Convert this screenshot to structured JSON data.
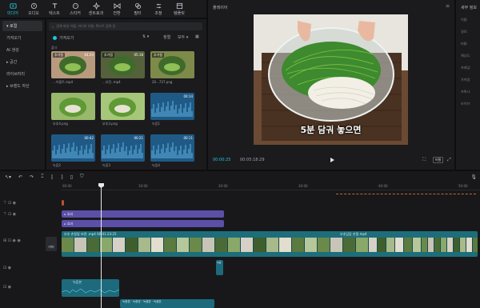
{
  "toolbar": {
    "items": [
      {
        "label": "미디어",
        "icon": "media-icon",
        "active": true
      },
      {
        "label": "오디오",
        "icon": "audio-icon"
      },
      {
        "label": "텍스트",
        "icon": "text-icon"
      },
      {
        "label": "스티커",
        "icon": "sticker-icon"
      },
      {
        "label": "센트효과",
        "icon": "effects-icon"
      },
      {
        "label": "전환",
        "icon": "transition-icon"
      },
      {
        "label": "필터",
        "icon": "filter-icon"
      },
      {
        "label": "조정",
        "icon": "adjust-icon"
      },
      {
        "label": "템플릿",
        "icon": "template-icon"
      }
    ]
  },
  "sidebar": {
    "items": [
      {
        "label": "▾ 로컬",
        "active": true
      },
      {
        "label": "가져오기"
      },
      {
        "label": "AI 생성"
      },
      {
        "label": "▸ 공간"
      },
      {
        "label": "라이브러리"
      },
      {
        "label": "▸ 브랜드 자산"
      }
    ]
  },
  "media": {
    "search_placeholder": "검색 파일 이름, 미디어 유형, 텍스트 검색 등",
    "import_label": "가져오기",
    "sort_label": "정렬",
    "filter_label": "모두",
    "section_label": "폴더",
    "items": [
      {
        "label": "...이들트.mp4",
        "duration": "04:24",
        "tag": "추가됨",
        "color": "#b89a7d"
      },
      {
        "label": "...부진..mp4",
        "duration": "05:18",
        "tag": "추가됨",
        "color": "#55613b"
      },
      {
        "label": "20...727.png",
        "duration": "",
        "tag": "추가됨",
        "color": "#7d8a4a"
      },
      {
        "label": "부추4.png",
        "duration": "",
        "tag": "",
        "color": "#98b86b"
      },
      {
        "label": "부추3.png",
        "duration": "",
        "tag": "",
        "color": "#a6c67a"
      },
      {
        "label": "녹음1",
        "duration": "00:14",
        "tag": "",
        "color": "#1f5a86"
      },
      {
        "label": "녹음2",
        "duration": "00:42",
        "tag": "",
        "color": "#1f5a86"
      },
      {
        "label": "녹음3",
        "duration": "00:21",
        "tag": "",
        "color": "#1f5a86"
      },
      {
        "label": "녹음4",
        "duration": "00:11",
        "tag": "",
        "color": "#1f5a86"
      }
    ]
  },
  "player": {
    "title": "플레이어",
    "subtitle": "5분 담궈 놓으면",
    "current_time": "00:00:25",
    "total_time": "00:05:18:29",
    "ratio_label": "비율"
  },
  "right_panel": {
    "title": "세부 정보",
    "rows": [
      "이름:",
      "경로:",
      "비율:",
      "해상도:",
      "프레임:",
      "가져옴:",
      "프록시:",
      "라이브:"
    ]
  },
  "timeline": {
    "ticks": [
      "00:00",
      "10:00",
      "20:00",
      "30:00",
      "40:00",
      "50:00"
    ],
    "tracks": [
      {
        "label": "텍스트"
      },
      {
        "label": "텍스트2"
      },
      {
        "label": "비디오"
      },
      {
        "label": "오디오1"
      },
      {
        "label": "오디오2"
      }
    ],
    "text_clips": [
      {
        "label": "효과",
        "color": "#5c4fa8"
      },
      {
        "label": "효과",
        "color": "#5c4fa8"
      }
    ],
    "main_clip_label": "부추 손질및 보관 .mp4  00:01:23:25",
    "main_clip_label2": "부추담담 손질.mp4",
    "cover_label": "커버",
    "audio_label": "녹음본",
    "audio_small": "녹음",
    "colors": {
      "accent": "#22c3d6",
      "video": "#1d6e7a",
      "text": "#5c4fa8",
      "audio": "#1d6a7d"
    }
  }
}
